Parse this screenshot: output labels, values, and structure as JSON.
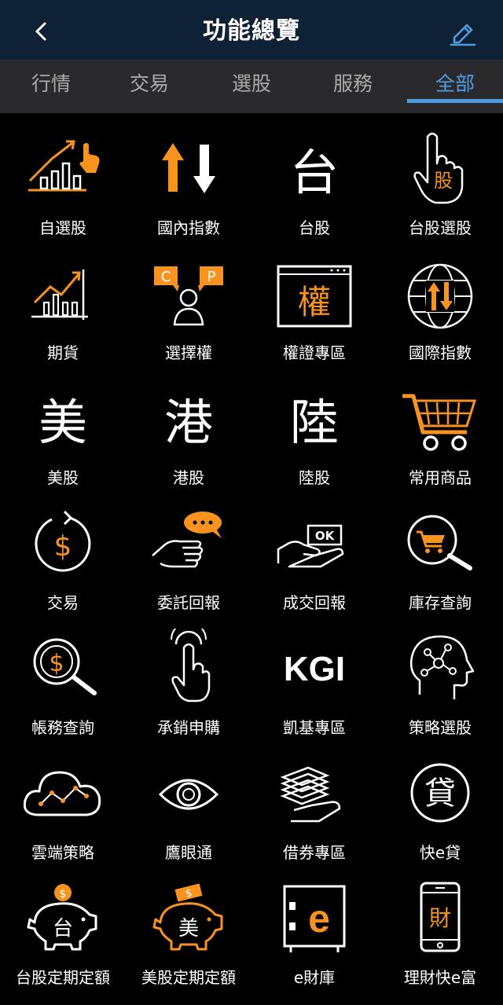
{
  "header": {
    "title": "功能總覽",
    "back_icon": "chevron-left-icon",
    "edit_icon": "pencil-icon"
  },
  "tabs": [
    "行情",
    "交易",
    "選股",
    "服務",
    "全部"
  ],
  "active_tab": "全部",
  "colors": {
    "accent": "#f7931e",
    "tab_active": "#4f9de0",
    "header_bg": "#0f2235"
  },
  "items": [
    {
      "label": "自選股",
      "icon": "chart-with-hand-icon"
    },
    {
      "label": "國內指數",
      "icon": "up-down-arrows-icon"
    },
    {
      "label": "台股",
      "icon": "tai-character-icon",
      "glyph": "台"
    },
    {
      "label": "台股選股",
      "icon": "pointing-hand-icon",
      "glyph": "股"
    },
    {
      "label": "期貨",
      "icon": "rising-chart-icon"
    },
    {
      "label": "選擇權",
      "icon": "call-put-person-icon",
      "glyph_c": "C",
      "glyph_p": "P"
    },
    {
      "label": "權證專區",
      "icon": "warrant-window-icon",
      "glyph": "權"
    },
    {
      "label": "國際指數",
      "icon": "globe-arrows-icon"
    },
    {
      "label": "美股",
      "icon": "mei-character-icon",
      "glyph": "美"
    },
    {
      "label": "港股",
      "icon": "gang-character-icon",
      "glyph": "港"
    },
    {
      "label": "陸股",
      "icon": "lu-character-icon",
      "glyph": "陸"
    },
    {
      "label": "常用商品",
      "icon": "shopping-cart-icon"
    },
    {
      "label": "交易",
      "icon": "dollar-cycle-icon",
      "glyph": "$"
    },
    {
      "label": "委託回報",
      "icon": "hand-speech-bubble-icon"
    },
    {
      "label": "成交回報",
      "icon": "hand-ok-bill-icon",
      "glyph": "OK"
    },
    {
      "label": "庫存查詢",
      "icon": "cart-magnifier-icon"
    },
    {
      "label": "帳務查詢",
      "icon": "dollar-magnifier-icon",
      "glyph": "$"
    },
    {
      "label": "承銷申購",
      "icon": "tapping-finger-icon"
    },
    {
      "label": "凱基專區",
      "icon": "kgi-logo-icon",
      "glyph": "KGI"
    },
    {
      "label": "策略選股",
      "icon": "brain-network-icon"
    },
    {
      "label": "雲端策略",
      "icon": "cloud-chart-icon"
    },
    {
      "label": "鷹眼通",
      "icon": "eye-icon"
    },
    {
      "label": "借券專區",
      "icon": "hand-money-stack-icon"
    },
    {
      "label": "快e貸",
      "icon": "loan-circle-icon",
      "glyph": "貸"
    },
    {
      "label": "台股定期定額",
      "icon": "piggy-bank-tw-icon",
      "glyph": "台"
    },
    {
      "label": "美股定期定額",
      "icon": "piggy-bank-us-icon",
      "glyph": "美"
    },
    {
      "label": "e財庫",
      "icon": "safe-icon",
      "glyph": "e"
    },
    {
      "label": "理財快e富",
      "icon": "phone-wealth-icon",
      "glyph": "財"
    }
  ]
}
